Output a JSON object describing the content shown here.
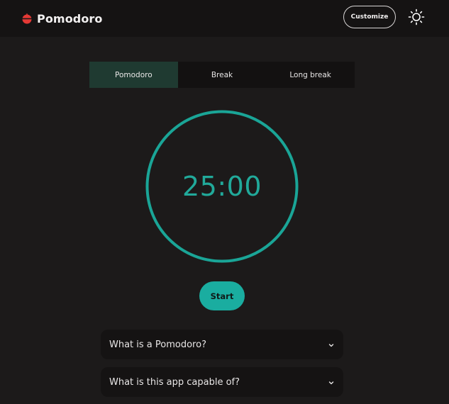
{
  "header": {
    "brand": "Pomodoro",
    "customize_label": "Customize",
    "theme_icon": "sun-icon",
    "brand_icon": "tomato-icon"
  },
  "tabs": [
    {
      "label": "Pomodoro",
      "active": true
    },
    {
      "label": "Break",
      "active": false
    },
    {
      "label": "Long break",
      "active": false
    }
  ],
  "timer": {
    "display": "25:00",
    "accent": "#21a99a"
  },
  "start_label": "Start",
  "faq": [
    {
      "question": "What is a Pomodoro?",
      "icon": "chevron-down-icon"
    },
    {
      "question": "What is this app capable of?",
      "icon": "chevron-down-icon"
    }
  ],
  "colors": {
    "background": "#1c1a1a",
    "header": "#151313",
    "active_tab": "#1f3a31",
    "start_button": "#1aada0",
    "brand_icon": "#e53935"
  }
}
